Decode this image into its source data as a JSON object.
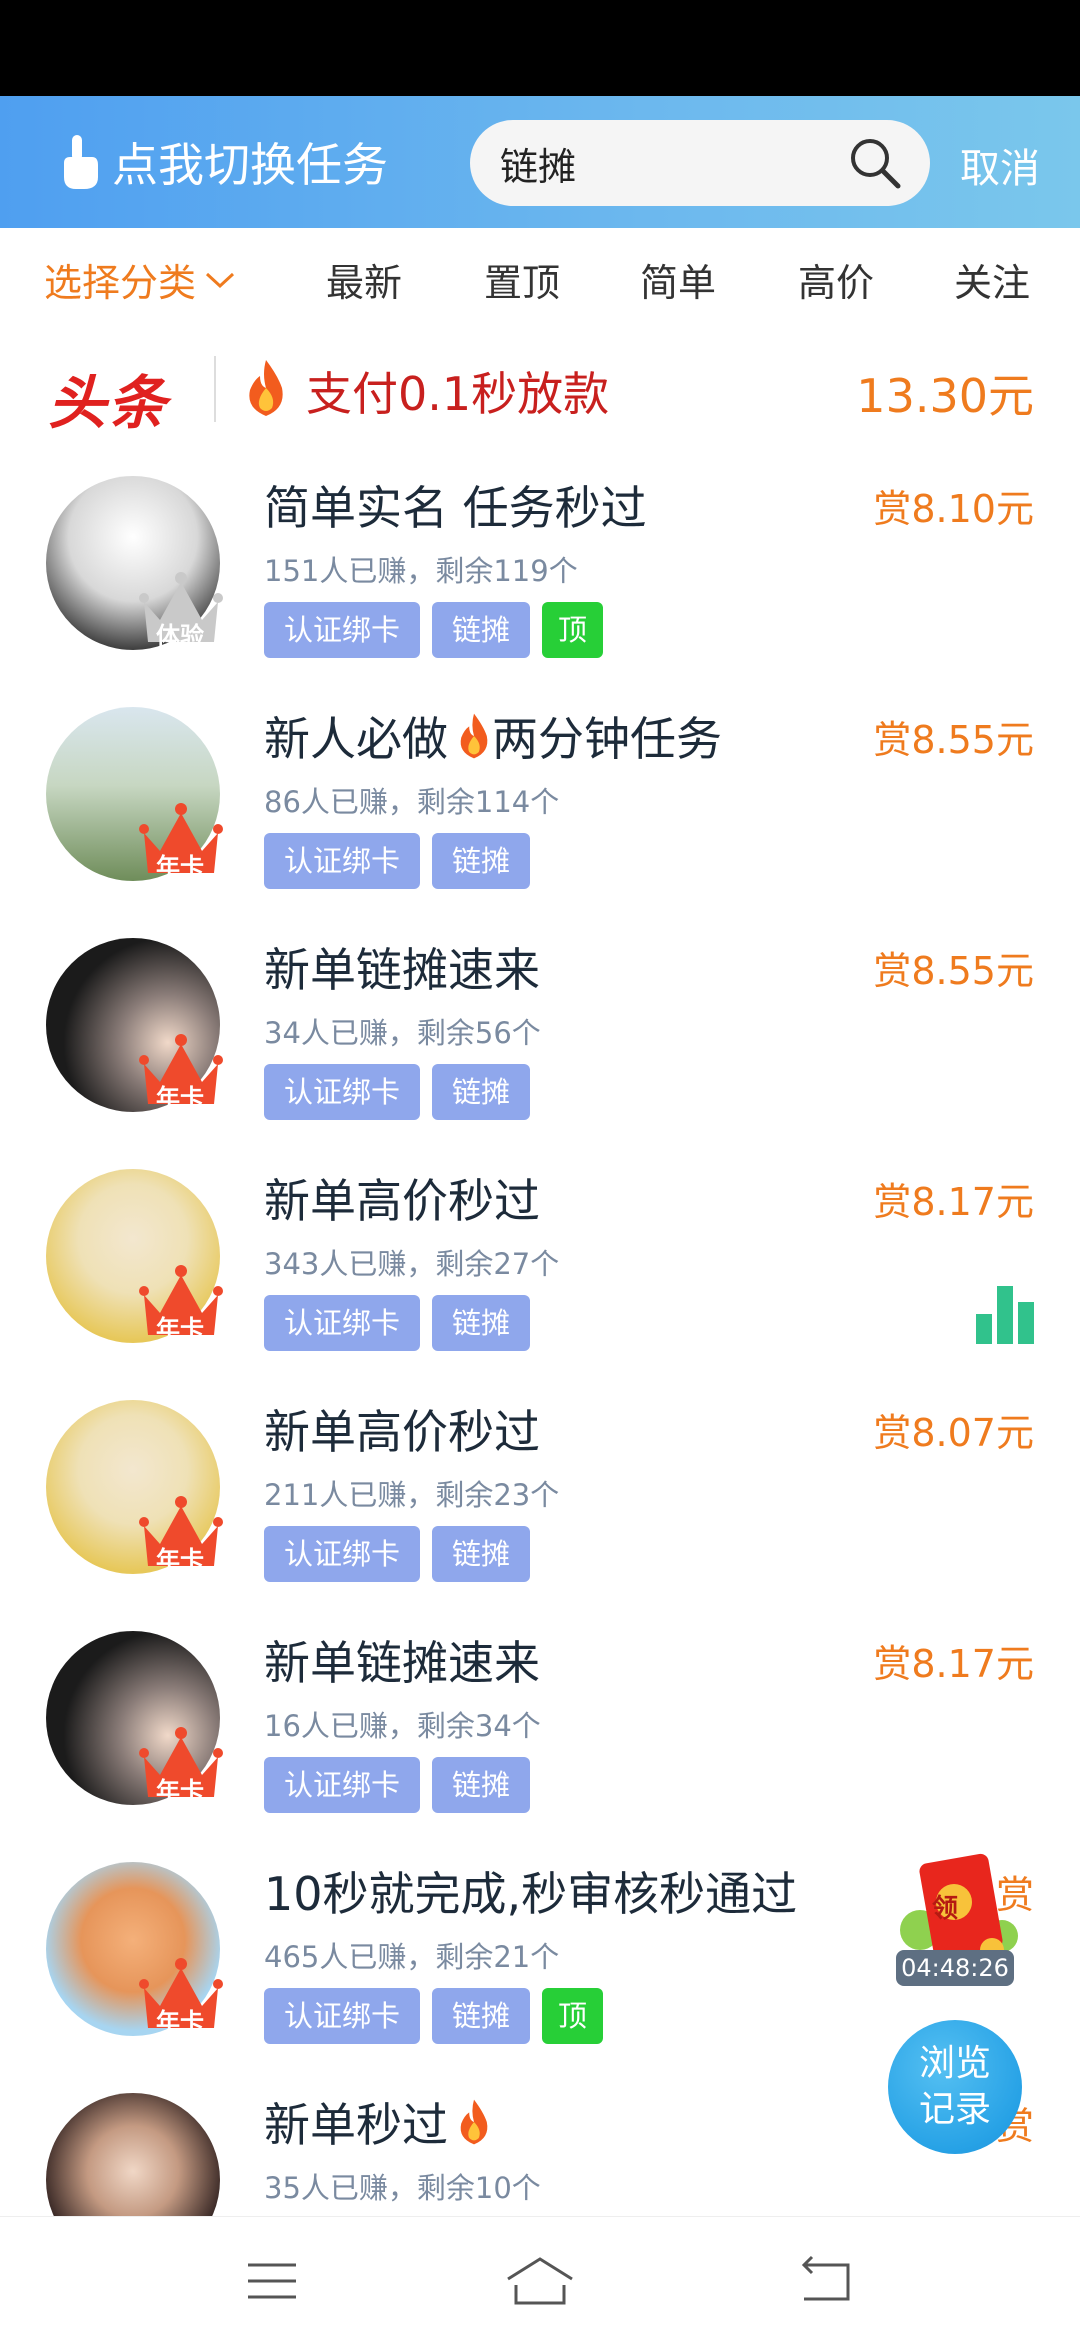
{
  "header": {
    "switch_label": "点我切换任务",
    "search_value": "链摊",
    "cancel_label": "取消"
  },
  "tabs": [
    "选择分类",
    "最新",
    "置顶",
    "简单",
    "高价",
    "关注"
  ],
  "headline": {
    "brand": "头条",
    "title": "支付0.1秒放款",
    "amount": "13.30元"
  },
  "tasks": [
    {
      "title": "简单实名 任务秒过",
      "stats": "151人已赚，剩余119个",
      "tags": [
        "认证绑卡",
        "链摊"
      ],
      "top": "顶",
      "reward": "赏8.10元",
      "badge": "体验"
    },
    {
      "title": "新人必做",
      "title2": "两分钟任务",
      "stats": "86人已赚，剩余114个",
      "tags": [
        "认证绑卡",
        "链摊"
      ],
      "reward": "赏8.55元",
      "badge": "年卡"
    },
    {
      "title": "新单链摊速来",
      "stats": "34人已赚，剩余56个",
      "tags": [
        "认证绑卡",
        "链摊"
      ],
      "reward": "赏8.55元",
      "badge": "年卡"
    },
    {
      "title": "新单高价秒过",
      "stats": "343人已赚，剩余27个",
      "tags": [
        "认证绑卡",
        "链摊"
      ],
      "reward": "赏8.17元",
      "badge": "年卡"
    },
    {
      "title": "新单高价秒过",
      "stats": "211人已赚，剩余23个",
      "tags": [
        "认证绑卡",
        "链摊"
      ],
      "reward": "赏8.07元",
      "badge": "年卡"
    },
    {
      "title": "新单链摊速来",
      "stats": "16人已赚，剩余34个",
      "tags": [
        "认证绑卡",
        "链摊"
      ],
      "reward": "赏8.17元",
      "badge": "年卡"
    },
    {
      "title": "10秒就完成,秒审核秒通过",
      "stats": "465人已赚，剩余21个",
      "tags": [
        "认证绑卡",
        "链摊"
      ],
      "top": "顶",
      "reward": "赏",
      "badge": "年卡"
    },
    {
      "title": "新单秒过",
      "stats": "35人已赚，剩余10个",
      "reward": "赏",
      "badge": ""
    }
  ],
  "float": {
    "envelope_label": "领",
    "timer": "04:48:26",
    "history_line1": "浏览",
    "history_line2": "记录"
  },
  "colors": {
    "accent_orange": "#ef7b1e",
    "tag_blue": "#8fa7ec",
    "tag_green": "#27cf37",
    "headline_red": "#c8201e"
  }
}
